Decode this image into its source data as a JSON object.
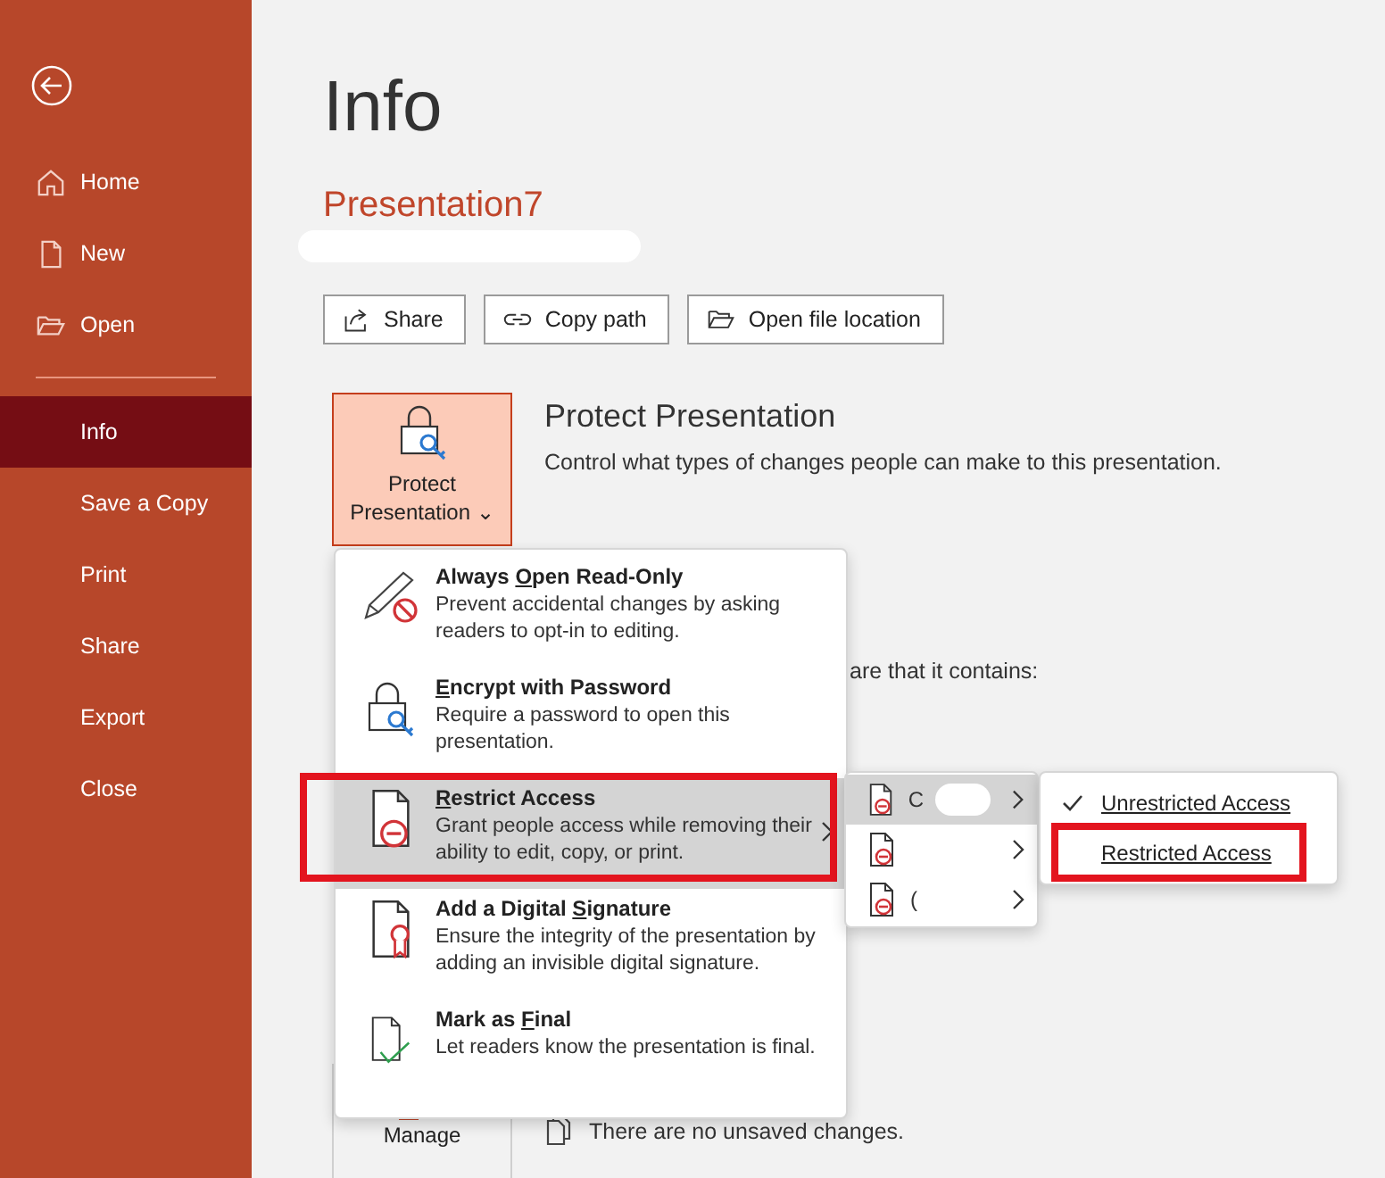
{
  "sidebar": {
    "items": [
      {
        "label": "Home",
        "selected": false
      },
      {
        "label": "New",
        "selected": false
      },
      {
        "label": "Open",
        "selected": false
      },
      {
        "label": "Info",
        "selected": true
      },
      {
        "label": "Save a Copy",
        "selected": false
      },
      {
        "label": "Print",
        "selected": false
      },
      {
        "label": "Share",
        "selected": false
      },
      {
        "label": "Export",
        "selected": false
      },
      {
        "label": "Close",
        "selected": false
      }
    ]
  },
  "page_title": "Info",
  "document_name": "Presentation7",
  "actions": [
    {
      "label": "Share"
    },
    {
      "label": "Copy path"
    },
    {
      "label": "Open file location"
    }
  ],
  "protect": {
    "button": "Protect Presentation",
    "caret": "⌄",
    "title": "Protect Presentation",
    "description": "Control what types of changes people can make to this presentation."
  },
  "background_fragments": [
    "are that it contains:",
    "There are no unsaved changes."
  ],
  "manage_button": "Manage",
  "protect_menu": [
    {
      "kind": "readonly",
      "title": "Always **O**pen Read-Only",
      "description": "Prevent accidental changes by asking readers to opt-in to editing.",
      "selected": false,
      "highlighted": false,
      "submenu": false
    },
    {
      "kind": "encrypt",
      "title": "**E**ncrypt with Password",
      "description": "Require a password to open this presentation.",
      "selected": false,
      "highlighted": false,
      "submenu": false
    },
    {
      "kind": "restrict",
      "title": "**R**estrict Access",
      "description": "Grant people access while removing their ability to edit, copy, or print.",
      "selected": true,
      "highlighted": true,
      "submenu": true
    },
    {
      "kind": "signature",
      "title": "Add a Digital **S**ignature",
      "description": "Ensure the integrity of the presentation by adding an invisible digital signature.",
      "selected": false,
      "highlighted": false,
      "submenu": false
    },
    {
      "kind": "final",
      "title": "Mark as **F**inal",
      "description": "Let readers know the presentation is final.",
      "selected": false,
      "highlighted": false,
      "submenu": false
    }
  ],
  "restrict_submenu": [
    {
      "label": "C",
      "selected": true
    },
    {
      "selected": false
    },
    {
      "label": "(",
      "selected": false
    }
  ],
  "access_menu": [
    {
      "label": "Unrestricted Access",
      "checked": true,
      "highlighted": false
    },
    {
      "label": "Restricted Access",
      "checked": false,
      "highlighted": true
    }
  ]
}
